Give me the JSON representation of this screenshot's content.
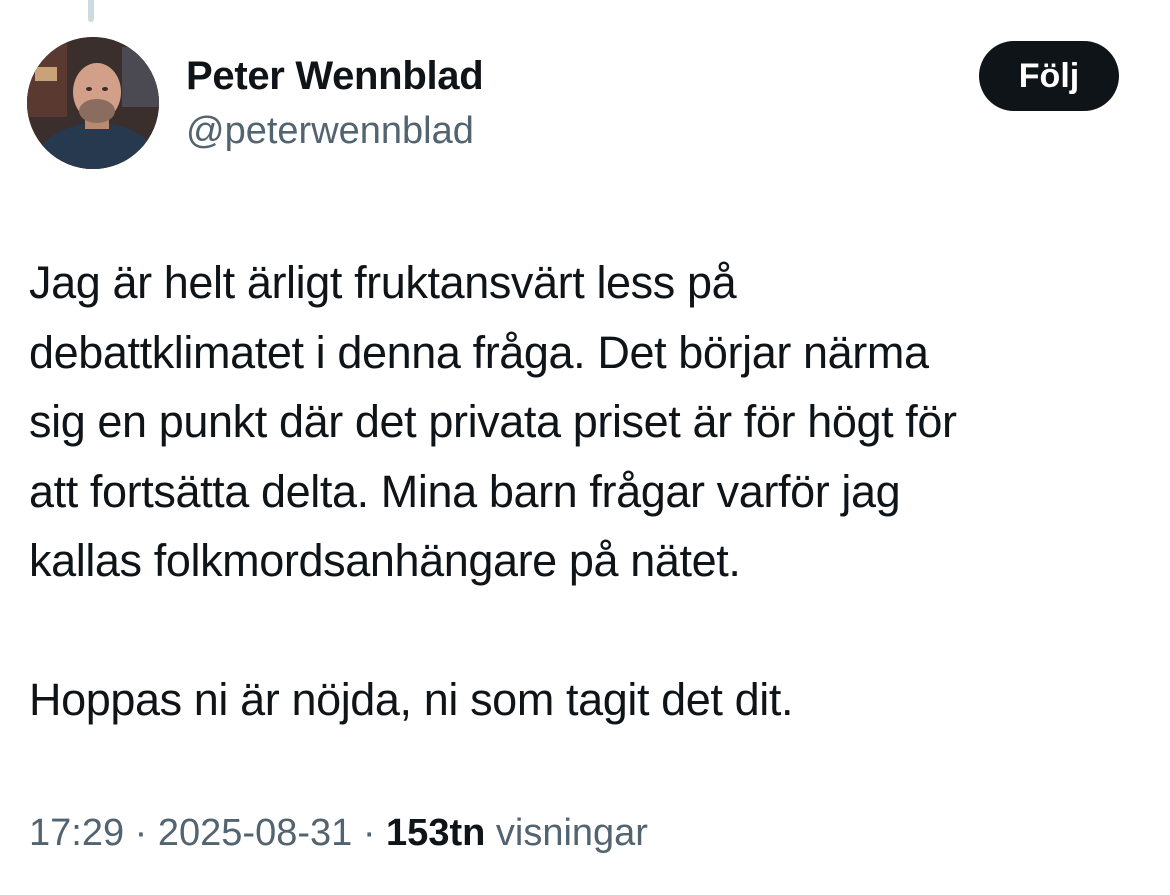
{
  "author": {
    "name": "Peter Wennblad",
    "handle": "@peterwennblad",
    "avatar_icon": "profile-photo-avatar"
  },
  "follow_label": "Följ",
  "tweet": {
    "paragraphs": [
      "Jag är helt ärligt fruktansvärt less på\ndebattklimatet i denna fråga. Det börjar närma\nsig en punkt där det privata priset är för högt för\natt fortsätta delta. Mina barn frågar varför jag\nkallas folkmordsanhängare på nätet.",
      "Hoppas ni är nöjda, ni som tagit det dit."
    ]
  },
  "meta": {
    "time": "17:29",
    "separator": " · ",
    "date": "2025-08-31",
    "views_count": "153tn",
    "views_label": " visningar"
  },
  "colors": {
    "text": "#0f1419",
    "secondary": "#536471",
    "button_bg": "#0f1419",
    "button_text": "#ffffff",
    "thread_line": "#cfd9de"
  }
}
